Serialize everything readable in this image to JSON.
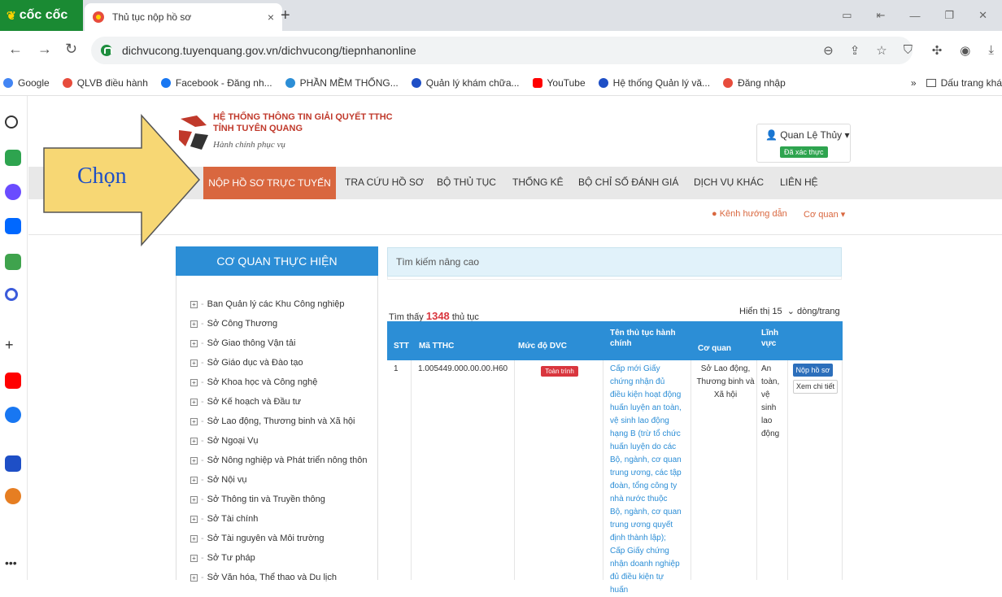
{
  "browser": {
    "brand": "cốc cốc",
    "tab_title": "Thủ tục nộp hồ sơ",
    "tab_close": "×",
    "new_tab": "+",
    "url": "dichvucong.tuyenquang.gov.vn/dichvucong/tiepnhanonline",
    "bookmarks": [
      {
        "label": "Google",
        "color": "#4285f4"
      },
      {
        "label": "QLVB điều hành",
        "color": "#e74c3c"
      },
      {
        "label": "Facebook - Đăng nh...",
        "color": "#1877f2"
      },
      {
        "label": "PHẦN MỀM THỐNG...",
        "color": "#2c8ed6"
      },
      {
        "label": "Quản lý khám chữa...",
        "color": "#1e4fc6"
      },
      {
        "label": "YouTube",
        "color": "#ff0000"
      },
      {
        "label": "Hệ thống Quản lý vă...",
        "color": "#1e4fc6"
      },
      {
        "label": "Đăng nhập",
        "color": "#e74c3c"
      }
    ],
    "bookmarks_more": "»",
    "bookmarks_folder": "Dấu trang khá"
  },
  "site": {
    "title_line1": "HỆ THỐNG THÔNG TIN GIẢI QUYẾT TTHC",
    "title_line2": "TỈNH TUYÊN QUANG",
    "slogan": "Hành chính phục vụ",
    "user_name": "Quan Lệ Thủy",
    "user_verified": "Đã xác thực"
  },
  "nav": {
    "active": "NỘP HỒ SƠ TRỰC TUYẾN",
    "items": [
      "TRA CỨU HỒ SƠ",
      "BỘ THỦ TỤC",
      "THỐNG KÊ",
      "BỘ CHỈ SỐ ĐÁNH GIÁ",
      "DỊCH VỤ KHÁC",
      "LIÊN HỆ"
    ],
    "guide": "Kênh hướng dẫn",
    "agency": "Cơ quan"
  },
  "annotation": {
    "label": "Chọn",
    "color": "#f7d774"
  },
  "agencies": {
    "header": "CƠ QUAN THỰC HIỆN",
    "items": [
      "Ban Quản lý các Khu Công nghiệp",
      "Sở Công Thương",
      "Sở Giao thông Vận tải",
      "Sở Giáo dục và Đào tạo",
      "Sở Khoa học và Công nghệ",
      "Sở Kế hoạch và Đầu tư",
      "Sở Lao động, Thương binh và Xã hội",
      "Sở Ngoại Vụ",
      "Sở Nông nghiệp và Phát triển nông thôn",
      "Sở Nội vụ",
      "Sở Thông tin và Truyền thông",
      "Sở Tài chính",
      "Sở Tài nguyên và Môi trường",
      "Sở Tư pháp",
      "Sở Văn hóa, Thể thao và Du lịch"
    ]
  },
  "search": {
    "advanced": "Tìm kiếm nâng cao",
    "found_prefix": "Tìm thấy",
    "found_count": "1348",
    "found_suffix": "thủ tục",
    "per_page_prefix": "Hiển thị",
    "per_page_value": "15",
    "per_page_suffix": "dòng/trang"
  },
  "table": {
    "headers": [
      "STT",
      "Mã TTHC",
      "Mức độ DVC",
      "Tên thủ tục hành chính",
      "Cơ quan",
      "Lĩnh vực"
    ],
    "rows": [
      {
        "stt": "1",
        "code": "1.005449.000.00.00.H60",
        "level": "Toàn trình",
        "name": "Cấp mới Giấy chứng nhận đủ điều kiện hoạt động huấn luyện an toàn, vệ sinh lao động hạng B (trừ tổ chức huấn luyện do các Bộ, ngành, cơ quan trung ương, các tập đoàn, tổng công ty nhà nước thuộc Bộ, ngành, cơ quan trung ương quyết định thành lập); Cấp Giấy chứng nhận doanh nghiệp đủ điều kiện tự huấn",
        "agency": "Sở Lao động, Thương binh và Xã hội",
        "field": "An toàn, vệ sinh lao động",
        "btn_submit": "Nộp hồ sơ",
        "btn_detail": "Xem chi tiết"
      }
    ]
  }
}
